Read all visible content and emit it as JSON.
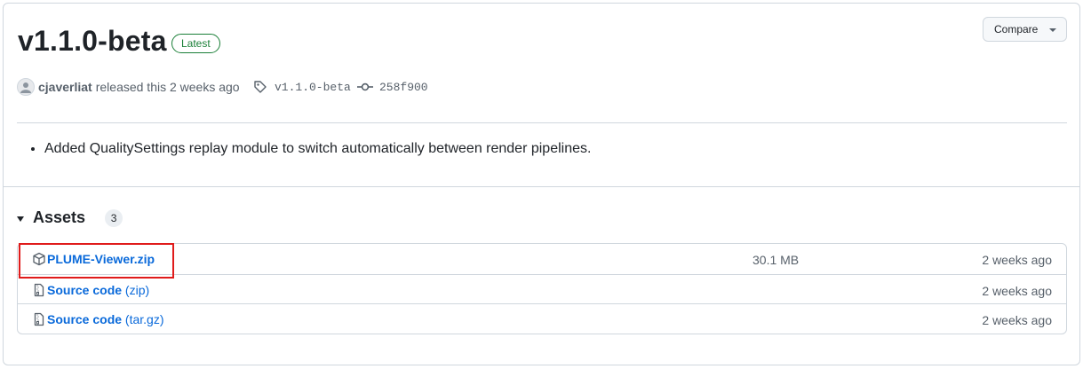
{
  "release": {
    "title": "v1.1.0-beta",
    "badge": "Latest",
    "compare_label": "Compare",
    "author": "cjaverliat",
    "released_text": "released this 2 weeks ago",
    "tag": "v1.1.0-beta",
    "commit": "258f900",
    "notes": [
      "Added QualitySettings replay module to switch automatically between render pipelines."
    ]
  },
  "assets": {
    "title": "Assets",
    "count": "3",
    "items": [
      {
        "name": "PLUME-Viewer.zip",
        "suffix": "",
        "size": "30.1 MB",
        "date": "2 weeks ago",
        "icon": "package-icon"
      },
      {
        "name": "Source code",
        "suffix": " (zip)",
        "size": "",
        "date": "2 weeks ago",
        "icon": "file-zip-icon"
      },
      {
        "name": "Source code",
        "suffix": " (tar.gz)",
        "size": "",
        "date": "2 weeks ago",
        "icon": "file-zip-icon"
      }
    ]
  },
  "colors": {
    "accent_link": "#0969da",
    "latest_green": "#1a7f37",
    "highlight_red": "#e01b1b"
  }
}
